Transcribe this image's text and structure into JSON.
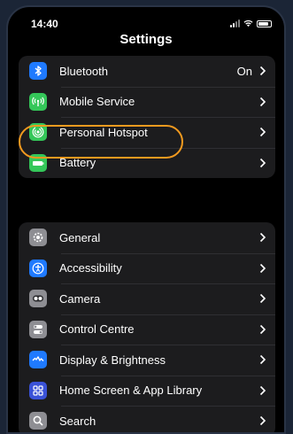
{
  "status": {
    "time": "14:40"
  },
  "header": {
    "title": "Settings"
  },
  "groups": [
    [
      {
        "label": "Bluetooth",
        "value": "On",
        "icon": "bluetooth-icon",
        "color": "#1f7aff"
      },
      {
        "label": "Mobile Service",
        "value": "",
        "icon": "antenna-icon",
        "color": "#34c759"
      },
      {
        "label": "Personal Hotspot",
        "value": "",
        "icon": "hotspot-icon",
        "color": "#34c759"
      },
      {
        "label": "Battery",
        "value": "",
        "icon": "battery-icon",
        "color": "#34c759"
      }
    ],
    [
      {
        "label": "General",
        "value": "",
        "icon": "gear-icon",
        "color": "#8e8e93"
      },
      {
        "label": "Accessibility",
        "value": "",
        "icon": "accessibility-icon",
        "color": "#1f7aff"
      },
      {
        "label": "Camera",
        "value": "",
        "icon": "camera-icon",
        "color": "#8e8e93"
      },
      {
        "label": "Control Centre",
        "value": "",
        "icon": "switches-icon",
        "color": "#8e8e93"
      },
      {
        "label": "Display & Brightness",
        "value": "",
        "icon": "brightness-icon",
        "color": "#1f7aff"
      },
      {
        "label": "Home Screen & App Library",
        "value": "",
        "icon": "home-screen-icon",
        "color": "#3a52d8"
      },
      {
        "label": "Search",
        "value": "",
        "icon": "search-icon",
        "color": "#8e8e93"
      }
    ]
  ],
  "highlight_color": "#f29a1f"
}
